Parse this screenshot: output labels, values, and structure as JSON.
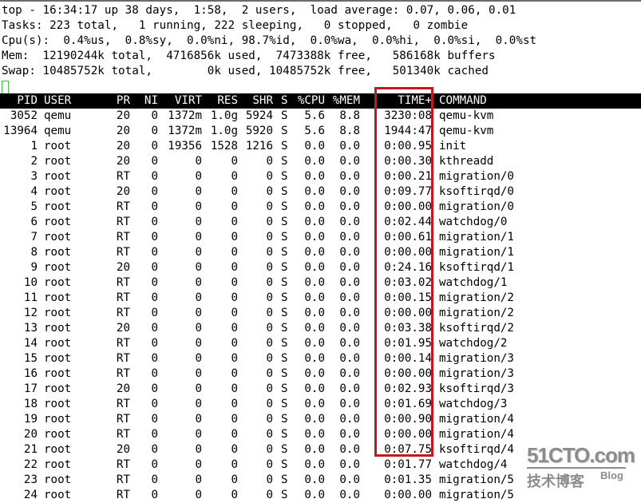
{
  "summary": {
    "uptime_line": "top - 16:34:17 up 38 days,  1:58,  2 users,  load average: 0.07, 0.06, 0.01",
    "tasks_line": "Tasks: 223 total,   1 running, 222 sleeping,   0 stopped,   0 zombie",
    "cpu_line": "Cpu(s):  0.4%us,  0.8%sy,  0.0%ni, 98.7%id,  0.0%wa,  0.0%hi,  0.0%si,  0.0%st",
    "mem_line": "Mem:  12190244k total,  4716856k used,  7473388k free,   586168k buffers",
    "swap_line": "Swap: 10485752k total,        0k used, 10485752k free,   501340k cached"
  },
  "table": {
    "columns": [
      "PID",
      "USER",
      "PR",
      "NI",
      "VIRT",
      "RES",
      "SHR",
      "S",
      "%CPU",
      "%MEM",
      "TIME+",
      "COMMAND"
    ],
    "highlighted_column": "TIME+",
    "highlight_color": "#c8161c",
    "rows": [
      {
        "pid": "3052",
        "user": "qemu",
        "pr": "20",
        "ni": "0",
        "virt": "1372m",
        "res": "1.0g",
        "shr": "5924",
        "s": "S",
        "cpu": "5.6",
        "mem": "8.8",
        "time": "3230:08",
        "command": "qemu-kvm"
      },
      {
        "pid": "13964",
        "user": "qemu",
        "pr": "20",
        "ni": "0",
        "virt": "1372m",
        "res": "1.0g",
        "shr": "5920",
        "s": "S",
        "cpu": "5.6",
        "mem": "8.8",
        "time": "1944:47",
        "command": "qemu-kvm"
      },
      {
        "pid": "1",
        "user": "root",
        "pr": "20",
        "ni": "0",
        "virt": "19356",
        "res": "1528",
        "shr": "1216",
        "s": "S",
        "cpu": "0.0",
        "mem": "0.0",
        "time": "0:00.95",
        "command": "init"
      },
      {
        "pid": "2",
        "user": "root",
        "pr": "20",
        "ni": "0",
        "virt": "0",
        "res": "0",
        "shr": "0",
        "s": "S",
        "cpu": "0.0",
        "mem": "0.0",
        "time": "0:00.30",
        "command": "kthreadd"
      },
      {
        "pid": "3",
        "user": "root",
        "pr": "RT",
        "ni": "0",
        "virt": "0",
        "res": "0",
        "shr": "0",
        "s": "S",
        "cpu": "0.0",
        "mem": "0.0",
        "time": "0:00.21",
        "command": "migration/0"
      },
      {
        "pid": "4",
        "user": "root",
        "pr": "20",
        "ni": "0",
        "virt": "0",
        "res": "0",
        "shr": "0",
        "s": "S",
        "cpu": "0.0",
        "mem": "0.0",
        "time": "0:09.77",
        "command": "ksoftirqd/0"
      },
      {
        "pid": "5",
        "user": "root",
        "pr": "RT",
        "ni": "0",
        "virt": "0",
        "res": "0",
        "shr": "0",
        "s": "S",
        "cpu": "0.0",
        "mem": "0.0",
        "time": "0:00.00",
        "command": "migration/0"
      },
      {
        "pid": "6",
        "user": "root",
        "pr": "RT",
        "ni": "0",
        "virt": "0",
        "res": "0",
        "shr": "0",
        "s": "S",
        "cpu": "0.0",
        "mem": "0.0",
        "time": "0:02.44",
        "command": "watchdog/0"
      },
      {
        "pid": "7",
        "user": "root",
        "pr": "RT",
        "ni": "0",
        "virt": "0",
        "res": "0",
        "shr": "0",
        "s": "S",
        "cpu": "0.0",
        "mem": "0.0",
        "time": "0:00.61",
        "command": "migration/1"
      },
      {
        "pid": "8",
        "user": "root",
        "pr": "RT",
        "ni": "0",
        "virt": "0",
        "res": "0",
        "shr": "0",
        "s": "S",
        "cpu": "0.0",
        "mem": "0.0",
        "time": "0:00.00",
        "command": "migration/1"
      },
      {
        "pid": "9",
        "user": "root",
        "pr": "20",
        "ni": "0",
        "virt": "0",
        "res": "0",
        "shr": "0",
        "s": "S",
        "cpu": "0.0",
        "mem": "0.0",
        "time": "0:24.16",
        "command": "ksoftirqd/1"
      },
      {
        "pid": "10",
        "user": "root",
        "pr": "RT",
        "ni": "0",
        "virt": "0",
        "res": "0",
        "shr": "0",
        "s": "S",
        "cpu": "0.0",
        "mem": "0.0",
        "time": "0:03.02",
        "command": "watchdog/1"
      },
      {
        "pid": "11",
        "user": "root",
        "pr": "RT",
        "ni": "0",
        "virt": "0",
        "res": "0",
        "shr": "0",
        "s": "S",
        "cpu": "0.0",
        "mem": "0.0",
        "time": "0:00.15",
        "command": "migration/2"
      },
      {
        "pid": "12",
        "user": "root",
        "pr": "RT",
        "ni": "0",
        "virt": "0",
        "res": "0",
        "shr": "0",
        "s": "S",
        "cpu": "0.0",
        "mem": "0.0",
        "time": "0:00.00",
        "command": "migration/2"
      },
      {
        "pid": "13",
        "user": "root",
        "pr": "20",
        "ni": "0",
        "virt": "0",
        "res": "0",
        "shr": "0",
        "s": "S",
        "cpu": "0.0",
        "mem": "0.0",
        "time": "0:03.38",
        "command": "ksoftirqd/2"
      },
      {
        "pid": "14",
        "user": "root",
        "pr": "RT",
        "ni": "0",
        "virt": "0",
        "res": "0",
        "shr": "0",
        "s": "S",
        "cpu": "0.0",
        "mem": "0.0",
        "time": "0:01.95",
        "command": "watchdog/2"
      },
      {
        "pid": "15",
        "user": "root",
        "pr": "RT",
        "ni": "0",
        "virt": "0",
        "res": "0",
        "shr": "0",
        "s": "S",
        "cpu": "0.0",
        "mem": "0.0",
        "time": "0:00.14",
        "command": "migration/3"
      },
      {
        "pid": "16",
        "user": "root",
        "pr": "RT",
        "ni": "0",
        "virt": "0",
        "res": "0",
        "shr": "0",
        "s": "S",
        "cpu": "0.0",
        "mem": "0.0",
        "time": "0:00.00",
        "command": "migration/3"
      },
      {
        "pid": "17",
        "user": "root",
        "pr": "20",
        "ni": "0",
        "virt": "0",
        "res": "0",
        "shr": "0",
        "s": "S",
        "cpu": "0.0",
        "mem": "0.0",
        "time": "0:02.93",
        "command": "ksoftirqd/3"
      },
      {
        "pid": "18",
        "user": "root",
        "pr": "RT",
        "ni": "0",
        "virt": "0",
        "res": "0",
        "shr": "0",
        "s": "S",
        "cpu": "0.0",
        "mem": "0.0",
        "time": "0:01.69",
        "command": "watchdog/3"
      },
      {
        "pid": "19",
        "user": "root",
        "pr": "RT",
        "ni": "0",
        "virt": "0",
        "res": "0",
        "shr": "0",
        "s": "S",
        "cpu": "0.0",
        "mem": "0.0",
        "time": "0:00.90",
        "command": "migration/4"
      },
      {
        "pid": "20",
        "user": "root",
        "pr": "RT",
        "ni": "0",
        "virt": "0",
        "res": "0",
        "shr": "0",
        "s": "S",
        "cpu": "0.0",
        "mem": "0.0",
        "time": "0:00.00",
        "command": "migration/4"
      },
      {
        "pid": "21",
        "user": "root",
        "pr": "20",
        "ni": "0",
        "virt": "0",
        "res": "0",
        "shr": "0",
        "s": "S",
        "cpu": "0.0",
        "mem": "0.0",
        "time": "0:07.75",
        "command": "ksoftirqd/4"
      },
      {
        "pid": "22",
        "user": "root",
        "pr": "RT",
        "ni": "0",
        "virt": "0",
        "res": "0",
        "shr": "0",
        "s": "S",
        "cpu": "0.0",
        "mem": "0.0",
        "time": "0:01.77",
        "command": "watchdog/4"
      },
      {
        "pid": "23",
        "user": "root",
        "pr": "RT",
        "ni": "0",
        "virt": "0",
        "res": "0",
        "shr": "0",
        "s": "S",
        "cpu": "0.0",
        "mem": "0.0",
        "time": "0:01.35",
        "command": "migration/5"
      },
      {
        "pid": "24",
        "user": "root",
        "pr": "RT",
        "ni": "0",
        "virt": "0",
        "res": "0",
        "shr": "0",
        "s": "S",
        "cpu": "0.0",
        "mem": "0.0",
        "time": "0:00.00",
        "command": "migration/5"
      }
    ]
  },
  "watermark": {
    "site": "51CTO.com",
    "subtitle": "技术博客",
    "blog": "Blog"
  }
}
